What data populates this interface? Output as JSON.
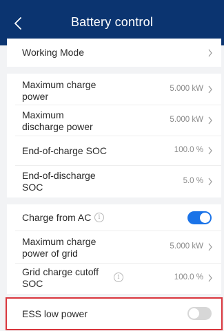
{
  "header": {
    "title": "Battery control",
    "back_icon": "chevron-left-icon",
    "bg_color": "#0b3470"
  },
  "rows": {
    "working_mode": {
      "label": "Working Mode"
    },
    "max_charge_power": {
      "label_line1": "Maximum charge",
      "label_line2": "power",
      "value": "5.000  kW"
    },
    "max_discharge_power": {
      "label_line1": "Maximum",
      "label_line2": "discharge power",
      "value": "5.000  kW"
    },
    "end_of_charge_soc": {
      "label": "End-of-charge SOC",
      "value": "100.0  %"
    },
    "end_of_discharge_soc": {
      "label_line1": "End-of-discharge",
      "label_line2": "SOC",
      "value": "5.0  %"
    },
    "charge_from_ac": {
      "label": "Charge from AC",
      "toggle_on": true
    },
    "max_charge_power_grid": {
      "label_line1": "Maximum charge",
      "label_line2": "power of grid",
      "value": "5.000  kW"
    },
    "grid_charge_cutoff_soc": {
      "label_line1": "Grid charge cutoff",
      "label_line2": "SOC",
      "value": "100.0  %"
    },
    "ess_low_power": {
      "label": "ESS low power",
      "toggle_on": false
    }
  },
  "colors": {
    "toggle_on": "#1a73e8",
    "toggle_off": "#d7d7d7",
    "highlight_border": "#d9353c"
  }
}
